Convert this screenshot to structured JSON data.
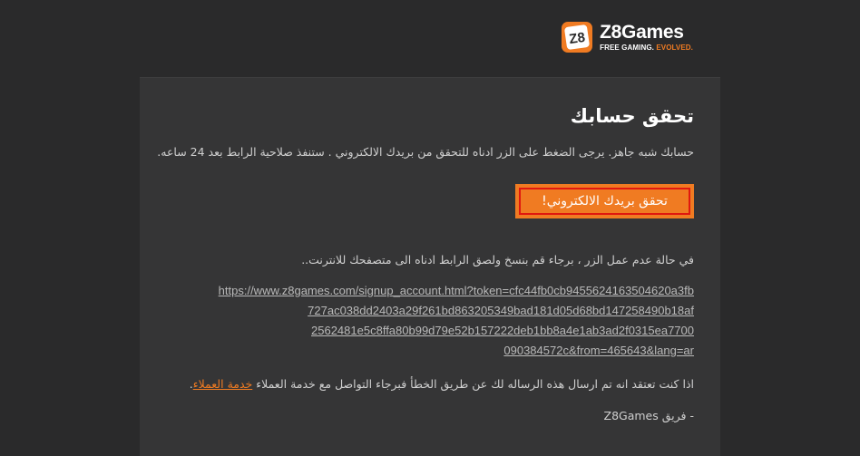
{
  "brand": {
    "name": "Z8Games",
    "tagline_main": "FREE GAMING.",
    "tagline_accent": "EVOLVED.",
    "logo_mark_text": "Z8",
    "colors": {
      "accent": "#f07b22",
      "button_border": "#e0180f",
      "background": "#2a2a2b",
      "card": "#353536"
    }
  },
  "email": {
    "title": "تحقق حسابك",
    "intro": "حسابك شبه جاهز. يرجى الضغط على الزر ادناه للتحقق من بريدك الالكتروني . ستنفذ صلاحية الرابط بعد 24 ساعه.",
    "cta_label": "تحقق بريدك الالكتروني!",
    "fallback_text": "في حالة عدم عمل الزر ، برجاء قم بنسخ ولصق الرابط ادناه الى متصفحك للانترنت..",
    "verification_url_lines": [
      "https://www.z8games.com/signup_account.html?token=cfc44fb0cb9455624163504620a3fb",
      "727ac038dd2403a29f261bd863205349bad181d05d68bd147258490b18af",
      "2562481e5c8ffa80b99d79e52b157222deb1bb8a4e1ab3ad2f0315ea7700",
      "090384572c&from=465643&lang=ar"
    ],
    "support_text": "اذا كنت تعتقد انه تم ارسال هذه الرساله لك عن طريق الخطأ فبرجاء التواصل مع خدمة العملاء ",
    "support_link_label": "خدمة العملاء",
    "support_tail": ".",
    "signoff": "- فريق Z8Games"
  }
}
